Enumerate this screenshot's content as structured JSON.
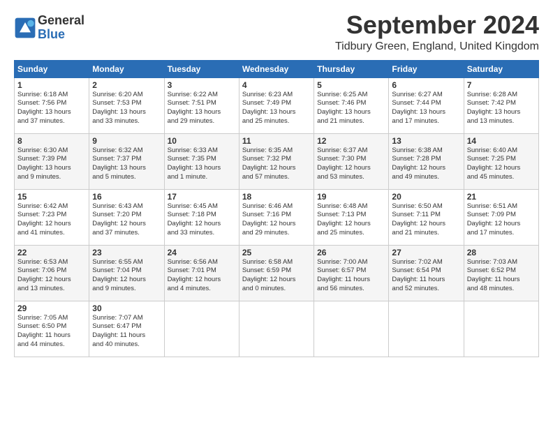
{
  "header": {
    "logo_line1": "General",
    "logo_line2": "Blue",
    "month_title": "September 2024",
    "location": "Tidbury Green, England, United Kingdom"
  },
  "weekdays": [
    "Sunday",
    "Monday",
    "Tuesday",
    "Wednesday",
    "Thursday",
    "Friday",
    "Saturday"
  ],
  "weeks": [
    [
      {
        "day": "1",
        "detail": "Sunrise: 6:18 AM\nSunset: 7:56 PM\nDaylight: 13 hours\nand 37 minutes."
      },
      {
        "day": "2",
        "detail": "Sunrise: 6:20 AM\nSunset: 7:53 PM\nDaylight: 13 hours\nand 33 minutes."
      },
      {
        "day": "3",
        "detail": "Sunrise: 6:22 AM\nSunset: 7:51 PM\nDaylight: 13 hours\nand 29 minutes."
      },
      {
        "day": "4",
        "detail": "Sunrise: 6:23 AM\nSunset: 7:49 PM\nDaylight: 13 hours\nand 25 minutes."
      },
      {
        "day": "5",
        "detail": "Sunrise: 6:25 AM\nSunset: 7:46 PM\nDaylight: 13 hours\nand 21 minutes."
      },
      {
        "day": "6",
        "detail": "Sunrise: 6:27 AM\nSunset: 7:44 PM\nDaylight: 13 hours\nand 17 minutes."
      },
      {
        "day": "7",
        "detail": "Sunrise: 6:28 AM\nSunset: 7:42 PM\nDaylight: 13 hours\nand 13 minutes."
      }
    ],
    [
      {
        "day": "8",
        "detail": "Sunrise: 6:30 AM\nSunset: 7:39 PM\nDaylight: 13 hours\nand 9 minutes."
      },
      {
        "day": "9",
        "detail": "Sunrise: 6:32 AM\nSunset: 7:37 PM\nDaylight: 13 hours\nand 5 minutes."
      },
      {
        "day": "10",
        "detail": "Sunrise: 6:33 AM\nSunset: 7:35 PM\nDaylight: 13 hours\nand 1 minute."
      },
      {
        "day": "11",
        "detail": "Sunrise: 6:35 AM\nSunset: 7:32 PM\nDaylight: 12 hours\nand 57 minutes."
      },
      {
        "day": "12",
        "detail": "Sunrise: 6:37 AM\nSunset: 7:30 PM\nDaylight: 12 hours\nand 53 minutes."
      },
      {
        "day": "13",
        "detail": "Sunrise: 6:38 AM\nSunset: 7:28 PM\nDaylight: 12 hours\nand 49 minutes."
      },
      {
        "day": "14",
        "detail": "Sunrise: 6:40 AM\nSunset: 7:25 PM\nDaylight: 12 hours\nand 45 minutes."
      }
    ],
    [
      {
        "day": "15",
        "detail": "Sunrise: 6:42 AM\nSunset: 7:23 PM\nDaylight: 12 hours\nand 41 minutes."
      },
      {
        "day": "16",
        "detail": "Sunrise: 6:43 AM\nSunset: 7:20 PM\nDaylight: 12 hours\nand 37 minutes."
      },
      {
        "day": "17",
        "detail": "Sunrise: 6:45 AM\nSunset: 7:18 PM\nDaylight: 12 hours\nand 33 minutes."
      },
      {
        "day": "18",
        "detail": "Sunrise: 6:46 AM\nSunset: 7:16 PM\nDaylight: 12 hours\nand 29 minutes."
      },
      {
        "day": "19",
        "detail": "Sunrise: 6:48 AM\nSunset: 7:13 PM\nDaylight: 12 hours\nand 25 minutes."
      },
      {
        "day": "20",
        "detail": "Sunrise: 6:50 AM\nSunset: 7:11 PM\nDaylight: 12 hours\nand 21 minutes."
      },
      {
        "day": "21",
        "detail": "Sunrise: 6:51 AM\nSunset: 7:09 PM\nDaylight: 12 hours\nand 17 minutes."
      }
    ],
    [
      {
        "day": "22",
        "detail": "Sunrise: 6:53 AM\nSunset: 7:06 PM\nDaylight: 12 hours\nand 13 minutes."
      },
      {
        "day": "23",
        "detail": "Sunrise: 6:55 AM\nSunset: 7:04 PM\nDaylight: 12 hours\nand 9 minutes."
      },
      {
        "day": "24",
        "detail": "Sunrise: 6:56 AM\nSunset: 7:01 PM\nDaylight: 12 hours\nand 4 minutes."
      },
      {
        "day": "25",
        "detail": "Sunrise: 6:58 AM\nSunset: 6:59 PM\nDaylight: 12 hours\nand 0 minutes."
      },
      {
        "day": "26",
        "detail": "Sunrise: 7:00 AM\nSunset: 6:57 PM\nDaylight: 11 hours\nand 56 minutes."
      },
      {
        "day": "27",
        "detail": "Sunrise: 7:02 AM\nSunset: 6:54 PM\nDaylight: 11 hours\nand 52 minutes."
      },
      {
        "day": "28",
        "detail": "Sunrise: 7:03 AM\nSunset: 6:52 PM\nDaylight: 11 hours\nand 48 minutes."
      }
    ],
    [
      {
        "day": "29",
        "detail": "Sunrise: 7:05 AM\nSunset: 6:50 PM\nDaylight: 11 hours\nand 44 minutes."
      },
      {
        "day": "30",
        "detail": "Sunrise: 7:07 AM\nSunset: 6:47 PM\nDaylight: 11 hours\nand 40 minutes."
      },
      {
        "day": "",
        "detail": ""
      },
      {
        "day": "",
        "detail": ""
      },
      {
        "day": "",
        "detail": ""
      },
      {
        "day": "",
        "detail": ""
      },
      {
        "day": "",
        "detail": ""
      }
    ]
  ]
}
